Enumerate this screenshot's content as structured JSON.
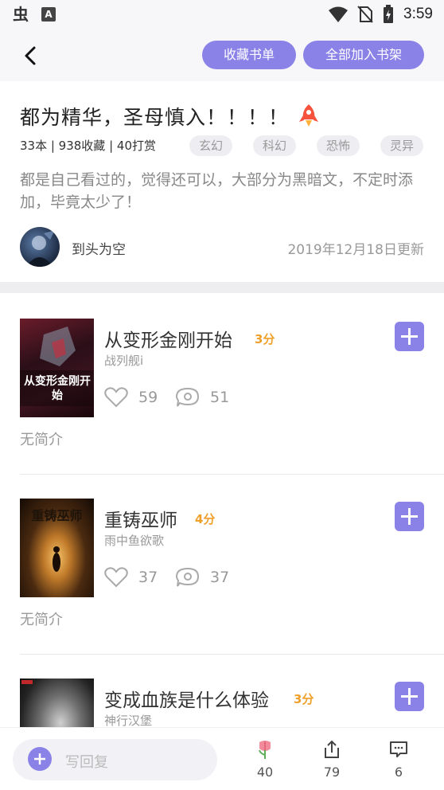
{
  "status_bar": {
    "time": "3:59",
    "app_glyph": "虫",
    "notif_glyph": "A"
  },
  "nav": {
    "favorites_button": "收藏书单",
    "add_all_button": "全部加入书架"
  },
  "booklist": {
    "title": "都为精华，圣母慎入！！！！",
    "stats": "33本 | 938收藏 | 40打赏",
    "tags": [
      "玄幻",
      "科幻",
      "恐怖",
      "灵异"
    ],
    "description": "都是自己看过的，觉得还可以，大部分为黑暗文，不定时添加，毕竟太少了！",
    "author": "到头为空",
    "updated": "2019年12月18日更新"
  },
  "books": [
    {
      "name": "从变形金刚开始",
      "score": "3分",
      "author": "战列舰i",
      "likes": "59",
      "comments": "51",
      "intro": "无简介",
      "cover_text": "从变形金刚开始"
    },
    {
      "name": "重铸巫师",
      "score": "4分",
      "author": "雨中鱼欲歌",
      "likes": "37",
      "comments": "37",
      "intro": "无简介",
      "cover_text": "重铸巫师"
    },
    {
      "name": "变成血族是什么体验",
      "score": "3分",
      "author": "神行汉堡"
    }
  ],
  "bottom": {
    "reply_placeholder": "写回复",
    "flowers": "40",
    "shares": "79",
    "messages": "6"
  },
  "colors": {
    "accent": "#8b82e8",
    "score": "#f0a02a"
  }
}
